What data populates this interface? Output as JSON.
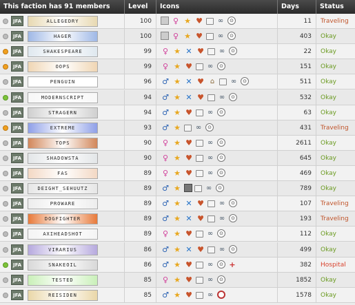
{
  "header": {
    "faction_label": "This faction has 91 members",
    "level": "Level",
    "icons": "Icons",
    "days": "Days",
    "status": "Status"
  },
  "rows": [
    {
      "tag": "JFA",
      "banner": "ALLEGEDRY",
      "banner_color": "#e8d9b2",
      "level": "100",
      "icons": [
        "grid",
        "female",
        "star",
        "heart",
        "case",
        "link",
        "clock"
      ],
      "days": "11",
      "status": "Traveling",
      "status_type": "travel",
      "dot": "offline"
    },
    {
      "tag": "JFA",
      "banner": "HAGER",
      "banner_color": "#9fb8e6",
      "level": "100",
      "icons": [
        "grid",
        "female",
        "star",
        "heart",
        "case",
        "link",
        "clock"
      ],
      "days": "403",
      "status": "Okay",
      "status_type": "okay",
      "dot": "offline"
    },
    {
      "tag": "JFA",
      "banner": "SHAKESPEARE",
      "banner_color": "#dfe8ef",
      "level": "99",
      "icons": [
        "female",
        "star",
        "cross",
        "heart",
        "case",
        "link",
        "clock"
      ],
      "days": "22",
      "status": "Okay",
      "status_type": "okay",
      "dot": "idle"
    },
    {
      "tag": "JFA",
      "banner": "OOPS",
      "banner_color": "#f0d6b4",
      "level": "99",
      "icons": [
        "female",
        "star",
        "heart",
        "case",
        "link",
        "clock"
      ],
      "days": "151",
      "status": "Okay",
      "status_type": "okay",
      "dot": "idle"
    },
    {
      "tag": "JFA",
      "banner": "PENGUIN",
      "banner_color": "#ffffff",
      "level": "96",
      "icons": [
        "male",
        "star",
        "cross",
        "heart",
        "bank",
        "case",
        "link",
        "clock"
      ],
      "days": "511",
      "status": "Okay",
      "status_type": "okay",
      "dot": "offline"
    },
    {
      "tag": "JFA",
      "banner": "MODERNSCRIPT",
      "banner_color": "#f7f7f7",
      "level": "94",
      "icons": [
        "male",
        "star",
        "cross",
        "heart",
        "case",
        "link",
        "clock"
      ],
      "days": "532",
      "status": "Okay",
      "status_type": "okay",
      "dot": "online"
    },
    {
      "tag": "JFA",
      "banner": "STRAGERN",
      "banner_color": "#cfcfcf",
      "level": "94",
      "icons": [
        "male",
        "star",
        "heart",
        "case",
        "link",
        "clock"
      ],
      "days": "63",
      "status": "Okay",
      "status_type": "okay",
      "dot": "offline"
    },
    {
      "tag": "JFA",
      "banner": "EXTREME",
      "banner_color": "#8fa0e8",
      "level": "93",
      "icons": [
        "male",
        "star",
        "case",
        "link",
        "clock"
      ],
      "days": "431",
      "status": "Traveling",
      "status_type": "travel",
      "dot": "idle"
    },
    {
      "tag": "JFA",
      "banner": "TOPS",
      "banner_color": "#d2875a",
      "level": "90",
      "icons": [
        "female",
        "star",
        "heart",
        "case",
        "link",
        "clock"
      ],
      "days": "2611",
      "status": "Okay",
      "status_type": "okay",
      "dot": "offline"
    },
    {
      "tag": "JFA",
      "banner": "SHADOWSTA",
      "banner_color": "#e3e6e8",
      "level": "90",
      "icons": [
        "female",
        "star",
        "heart",
        "case",
        "link",
        "clock"
      ],
      "days": "645",
      "status": "Okay",
      "status_type": "okay",
      "dot": "offline"
    },
    {
      "tag": "JFA",
      "banner": "FAS",
      "banner_color": "#f3d8c4",
      "level": "89",
      "icons": [
        "female",
        "star",
        "heart",
        "case",
        "link",
        "clock"
      ],
      "days": "469",
      "status": "Okay",
      "status_type": "okay",
      "dot": "offline"
    },
    {
      "tag": "JFA",
      "banner": "DEIGHT_SEHUUTZ",
      "banner_color": "#e6e6e6",
      "level": "89",
      "icons": [
        "male",
        "star",
        "jail",
        "case",
        "link",
        "clock"
      ],
      "days": "789",
      "status": "Okay",
      "status_type": "okay",
      "dot": "offline"
    },
    {
      "tag": "JFA",
      "banner": "PROWARE",
      "banner_color": "#ededed",
      "level": "89",
      "icons": [
        "male",
        "star",
        "cross",
        "heart",
        "case",
        "link",
        "clock"
      ],
      "days": "107",
      "status": "Traveling",
      "status_type": "travel",
      "dot": "offline"
    },
    {
      "tag": "JFA",
      "banner": "DOGFIGHTER",
      "banner_color": "#e87a3a",
      "level": "89",
      "icons": [
        "male",
        "star",
        "cross",
        "heart",
        "case",
        "link",
        "clock"
      ],
      "days": "193",
      "status": "Traveling",
      "status_type": "travel",
      "dot": "offline"
    },
    {
      "tag": "JFA",
      "banner": "AXIHEADSHOT",
      "banner_color": "#f4f4f4",
      "level": "89",
      "icons": [
        "female",
        "star",
        "heart",
        "case",
        "link",
        "clock"
      ],
      "days": "112",
      "status": "Okay",
      "status_type": "okay",
      "dot": "offline"
    },
    {
      "tag": "JFA",
      "banner": "VIRARIUS",
      "banner_color": "#b6a9de",
      "level": "86",
      "icons": [
        "male",
        "star",
        "cross",
        "heart",
        "case",
        "link",
        "clock"
      ],
      "days": "499",
      "status": "Okay",
      "status_type": "okay",
      "dot": "offline"
    },
    {
      "tag": "JFA",
      "banner": "SNAKEOIL",
      "banner_color": "#d8d8d8",
      "level": "86",
      "icons": [
        "male",
        "star",
        "heart",
        "case",
        "link",
        "clock",
        "hosp"
      ],
      "days": "382",
      "status": "Hospital",
      "status_type": "hosp",
      "dot": "online"
    },
    {
      "tag": "JFA",
      "banner": "TESTED",
      "banner_color": "#c9f0b8",
      "level": "85",
      "icons": [
        "female",
        "star",
        "heart",
        "case",
        "link",
        "clock"
      ],
      "days": "1852",
      "status": "Okay",
      "status_type": "okay",
      "dot": "offline"
    },
    {
      "tag": "JFA",
      "banner": "REISIDEN",
      "banner_color": "#ead7a8",
      "level": "85",
      "icons": [
        "male",
        "star",
        "heart",
        "case",
        "link",
        "target"
      ],
      "days": "1578",
      "status": "Okay",
      "status_type": "okay",
      "dot": "offline"
    }
  ]
}
